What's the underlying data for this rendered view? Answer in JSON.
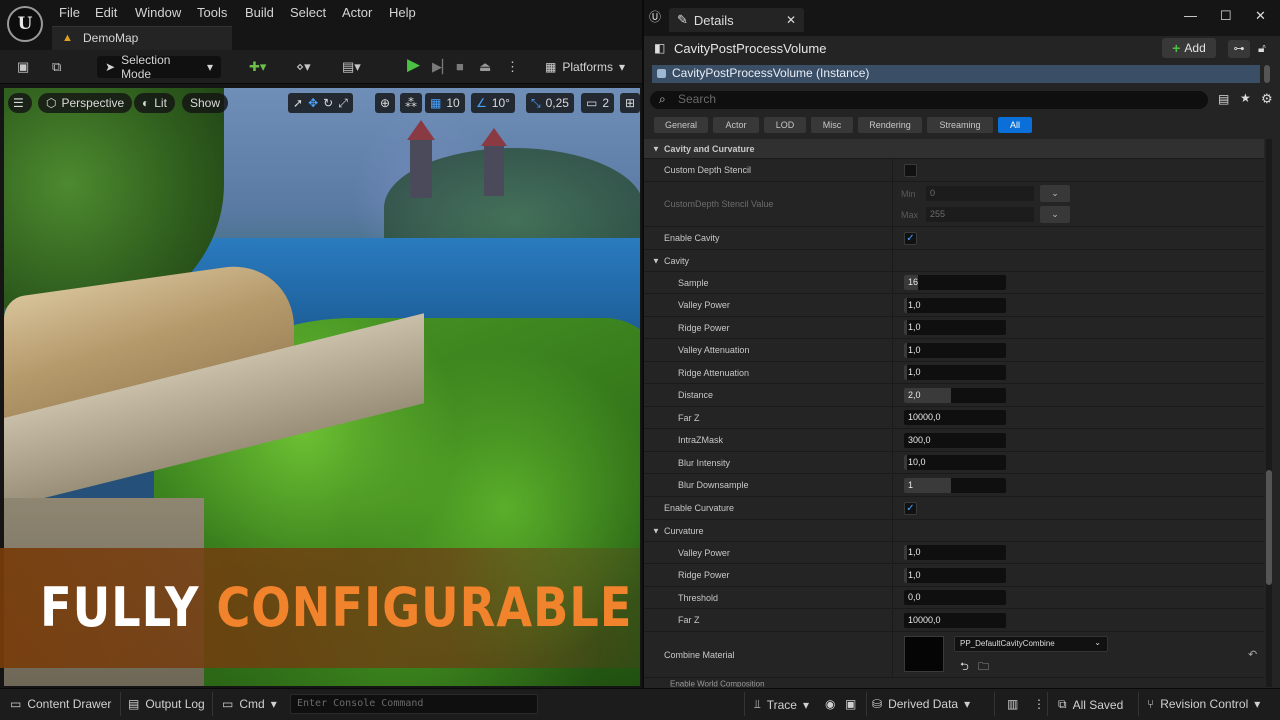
{
  "app": {
    "logo": "U",
    "menus": [
      "File",
      "Edit",
      "Window",
      "Tools",
      "Build",
      "Select",
      "Actor",
      "Help"
    ],
    "map_tab": "DemoMap"
  },
  "toolbar": {
    "mode": "Selection Mode",
    "platforms": "Platforms"
  },
  "viewport": {
    "perspective": "Perspective",
    "lit": "Lit",
    "show": "Show",
    "grid_snap": "10",
    "angle_snap": "10°",
    "scale_snap": "0,25",
    "camera_speed": "2"
  },
  "banner": {
    "word1": "FULLY",
    "word2": "CONFIGURABLE"
  },
  "statusbar": {
    "content_drawer": "Content Drawer",
    "output_log": "Output Log",
    "cmd": "Cmd",
    "console_placeholder": "Enter Console Command",
    "trace": "Trace",
    "derived_data": "Derived Data",
    "all_saved": "All Saved",
    "revision_control": "Revision Control"
  },
  "details": {
    "tab_label": "Details",
    "object_name": "CavityPostProcessVolume",
    "add_label": "Add",
    "instance": "CavityPostProcessVolume (Instance)",
    "search_placeholder": "Search",
    "filters": [
      "General",
      "Actor",
      "LOD",
      "Misc",
      "Rendering",
      "Streaming",
      "All"
    ],
    "section_cavity_curvature": "Cavity and Curvature",
    "custom_depth_stencil": "Custom Depth Stencil",
    "custom_depth_stencil_value": "CustomDepth Stencil Value",
    "min_label": "Min",
    "min_value": "0",
    "max_label": "Max",
    "max_value": "255",
    "enable_cavity": "Enable Cavity",
    "cavity_group": "Cavity",
    "cavity": [
      {
        "label": "Sample",
        "value": "16",
        "fill": 0.14
      },
      {
        "label": "Valley Power",
        "value": "1,0",
        "fill": 0.03
      },
      {
        "label": "Ridge Power",
        "value": "1,0",
        "fill": 0.03
      },
      {
        "label": "Valley Attenuation",
        "value": "1,0",
        "fill": 0.03
      },
      {
        "label": "Ridge Attenuation",
        "value": "1,0",
        "fill": 0.03
      },
      {
        "label": "Distance",
        "value": "2,0",
        "fill": 0.46
      },
      {
        "label": "Far Z",
        "value": "10000,0",
        "fill": 0
      },
      {
        "label": "IntraZMask",
        "value": "300,0",
        "fill": 0
      },
      {
        "label": "Blur Intensity",
        "value": "10,0",
        "fill": 0.03
      },
      {
        "label": "Blur Downsample",
        "value": "1",
        "fill": 0.46
      }
    ],
    "enable_curvature": "Enable Curvature",
    "curvature_group": "Curvature",
    "curvature": [
      {
        "label": "Valley Power",
        "value": "1,0",
        "fill": 0.03
      },
      {
        "label": "Ridge Power",
        "value": "1,0",
        "fill": 0.03
      },
      {
        "label": "Threshold",
        "value": "0,0",
        "fill": 0
      },
      {
        "label": "Far Z",
        "value": "10000,0",
        "fill": 0
      }
    ],
    "combine_material": "Combine Material",
    "combine_material_value": "PP_DefaultCavityCombine",
    "cut_off_row": "Enable World Composition"
  },
  "colors": {
    "accent": "#0a6fd8",
    "banner_orange": "#f0832b",
    "add_green": "#4bc043"
  }
}
